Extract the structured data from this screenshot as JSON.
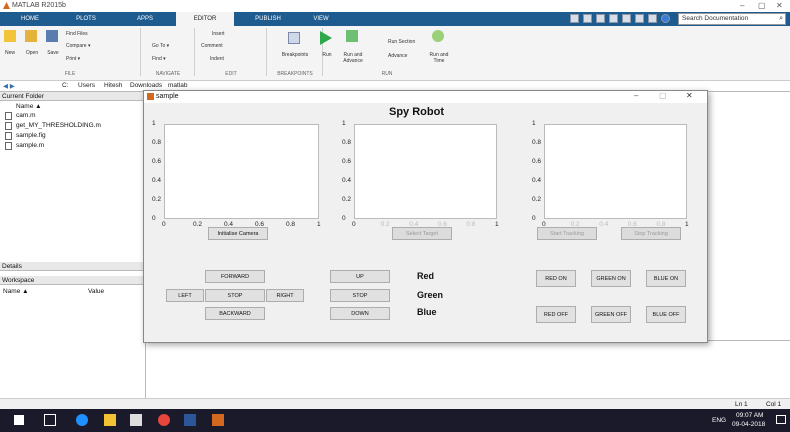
{
  "app": {
    "title": "MATLAB R2015b"
  },
  "tabs": [
    "HOME",
    "PLOTS",
    "APPS",
    "EDITOR",
    "PUBLISH",
    "VIEW"
  ],
  "search": {
    "placeholder": "Search Documentation"
  },
  "ribbon": {
    "file": [
      "New",
      "Open",
      "Save"
    ],
    "file_small": [
      "Find Files",
      "Compare ▾",
      "Print ▾"
    ],
    "navigate": [
      "Go To ▾",
      "Find ▾"
    ],
    "edit": [
      "Insert",
      "Comment",
      "Indent"
    ],
    "breakpoints": "Breakpoints",
    "run": [
      "Run",
      "Run and Advance",
      "Run Section",
      "Advance",
      "Run and Time"
    ],
    "groups": [
      "FILE",
      "NAVIGATE",
      "EDIT",
      "BREAKPOINTS",
      "RUN"
    ]
  },
  "address": [
    "C:",
    "Users",
    "Hitesh",
    "Downloads",
    "matlab"
  ],
  "left": {
    "current_folder": "Current Folder",
    "name_col": "Name ▲",
    "files": [
      "cam.m",
      "get_MY_THRESHOLDING.m",
      "sample.fig",
      "sample.m"
    ],
    "details": "Details",
    "workspace": "Workspace",
    "ws_cols": [
      "Name ▲",
      "Value"
    ]
  },
  "figure": {
    "window_title": "sample",
    "heading": "Spy Robot",
    "yticks": [
      "1",
      "0.8",
      "0.6",
      "0.4",
      "0.2",
      "0"
    ],
    "xticks": [
      "0",
      "0.2",
      "0.4",
      "0.6",
      "0.8",
      "1"
    ],
    "buttons": {
      "init": "Initialise Camera",
      "select": "Select Target",
      "start": "Start Tracking",
      "stop_track": "Stop Tracking",
      "forward": "FORWARD",
      "left": "LEFT",
      "stop": "STOP",
      "right": "RIGHT",
      "backward": "BACKWARD",
      "up": "UP",
      "stop2": "STOP",
      "down": "DOWN",
      "red_on": "RED ON",
      "green_on": "GREEN ON",
      "blue_on": "BLUE ON",
      "red_off": "RED OFF",
      "green_off": "GREEN OFF",
      "blue_off": "BLUE OFF"
    },
    "labels": {
      "red": "Red",
      "green": "Green",
      "blue": "Blue"
    }
  },
  "status": {
    "ln": "Ln 1",
    "col": "Col 1"
  },
  "clock": {
    "time": "09:07 AM",
    "date": "09-04-2018",
    "lang": "ENG"
  }
}
